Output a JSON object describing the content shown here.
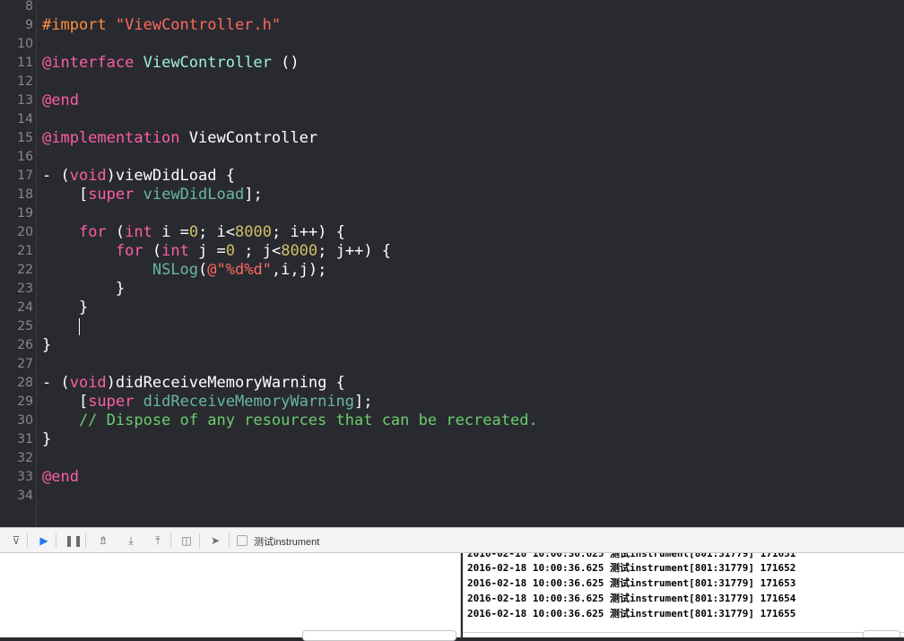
{
  "colors": {
    "editor_bg": "#292a30",
    "keyword": "#fc5fa3",
    "string": "#fc6a5d",
    "number": "#d0bf69",
    "comment": "#6bce6b",
    "class_name": "#9ef1dd",
    "method": "#67b7a4",
    "preprocessor": "#fd8f3f",
    "plain": "#ffffff",
    "line_number": "#868892"
  },
  "editor": {
    "lines": [
      {
        "num": "8",
        "tokens": []
      },
      {
        "num": "9",
        "tokens": [
          {
            "t": "#import ",
            "c": "#fd8f3f"
          },
          {
            "t": "\"ViewController.h\"",
            "c": "#fc6a5d"
          }
        ]
      },
      {
        "num": "10",
        "tokens": []
      },
      {
        "num": "11",
        "tokens": [
          {
            "t": "@interface",
            "c": "#fc5fa3"
          },
          {
            "t": " ",
            "c": "#ffffff"
          },
          {
            "t": "ViewController",
            "c": "#9ef1dd"
          },
          {
            "t": " ()",
            "c": "#ffffff"
          }
        ]
      },
      {
        "num": "12",
        "tokens": []
      },
      {
        "num": "13",
        "tokens": [
          {
            "t": "@end",
            "c": "#fc5fa3"
          }
        ]
      },
      {
        "num": "14",
        "tokens": []
      },
      {
        "num": "15",
        "tokens": [
          {
            "t": "@implementation",
            "c": "#fc5fa3"
          },
          {
            "t": " ViewController",
            "c": "#ffffff"
          }
        ]
      },
      {
        "num": "16",
        "tokens": []
      },
      {
        "num": "17",
        "tokens": [
          {
            "t": "- (",
            "c": "#ffffff"
          },
          {
            "t": "void",
            "c": "#fc5fa3"
          },
          {
            "t": ")viewDidLoad {",
            "c": "#ffffff"
          }
        ]
      },
      {
        "num": "18",
        "tokens": [
          {
            "t": "    [",
            "c": "#ffffff"
          },
          {
            "t": "super",
            "c": "#fc5fa3"
          },
          {
            "t": " ",
            "c": "#ffffff"
          },
          {
            "t": "viewDidLoad",
            "c": "#67b7a4"
          },
          {
            "t": "];",
            "c": "#ffffff"
          }
        ]
      },
      {
        "num": "19",
        "tokens": []
      },
      {
        "num": "20",
        "tokens": [
          {
            "t": "    ",
            "c": "#ffffff"
          },
          {
            "t": "for",
            "c": "#fc5fa3"
          },
          {
            "t": " (",
            "c": "#ffffff"
          },
          {
            "t": "int",
            "c": "#fc5fa3"
          },
          {
            "t": " i =",
            "c": "#ffffff"
          },
          {
            "t": "0",
            "c": "#d0bf69"
          },
          {
            "t": "; i<",
            "c": "#ffffff"
          },
          {
            "t": "8000",
            "c": "#d0bf69"
          },
          {
            "t": "; i++) {",
            "c": "#ffffff"
          }
        ]
      },
      {
        "num": "21",
        "tokens": [
          {
            "t": "        ",
            "c": "#ffffff"
          },
          {
            "t": "for",
            "c": "#fc5fa3"
          },
          {
            "t": " (",
            "c": "#ffffff"
          },
          {
            "t": "int",
            "c": "#fc5fa3"
          },
          {
            "t": " j =",
            "c": "#ffffff"
          },
          {
            "t": "0",
            "c": "#d0bf69"
          },
          {
            "t": " ; j<",
            "c": "#ffffff"
          },
          {
            "t": "8000",
            "c": "#d0bf69"
          },
          {
            "t": "; j++) {",
            "c": "#ffffff"
          }
        ]
      },
      {
        "num": "22",
        "tokens": [
          {
            "t": "            ",
            "c": "#ffffff"
          },
          {
            "t": "NSLog",
            "c": "#67b7a4"
          },
          {
            "t": "(",
            "c": "#ffffff"
          },
          {
            "t": "@\"%d%d\"",
            "c": "#fc6a5d"
          },
          {
            "t": ",i,j);",
            "c": "#ffffff"
          }
        ]
      },
      {
        "num": "23",
        "tokens": [
          {
            "t": "        }",
            "c": "#ffffff"
          }
        ]
      },
      {
        "num": "24",
        "tokens": [
          {
            "t": "    }",
            "c": "#ffffff"
          }
        ]
      },
      {
        "num": "25",
        "tokens": [
          {
            "t": "    ",
            "c": "#ffffff"
          }
        ],
        "cursor": true
      },
      {
        "num": "26",
        "tokens": [
          {
            "t": "}",
            "c": "#ffffff"
          }
        ]
      },
      {
        "num": "27",
        "tokens": []
      },
      {
        "num": "28",
        "tokens": [
          {
            "t": "- (",
            "c": "#ffffff"
          },
          {
            "t": "void",
            "c": "#fc5fa3"
          },
          {
            "t": ")didReceiveMemoryWarning {",
            "c": "#ffffff"
          }
        ]
      },
      {
        "num": "29",
        "tokens": [
          {
            "t": "    [",
            "c": "#ffffff"
          },
          {
            "t": "super",
            "c": "#fc5fa3"
          },
          {
            "t": " ",
            "c": "#ffffff"
          },
          {
            "t": "didReceiveMemoryWarning",
            "c": "#67b7a4"
          },
          {
            "t": "];",
            "c": "#ffffff"
          }
        ]
      },
      {
        "num": "30",
        "tokens": [
          {
            "t": "    // Dispose of any resources that can be recreated.",
            "c": "#6bce6b"
          }
        ]
      },
      {
        "num": "31",
        "tokens": [
          {
            "t": "}",
            "c": "#ffffff"
          }
        ]
      },
      {
        "num": "32",
        "tokens": []
      },
      {
        "num": "33",
        "tokens": [
          {
            "t": "@end",
            "c": "#fc5fa3"
          }
        ]
      },
      {
        "num": "34",
        "tokens": []
      }
    ]
  },
  "debug_bar": {
    "buttons": [
      {
        "name": "hide-debug-area-icon",
        "glyph": "⊽"
      },
      {
        "name": "breakpoints-toggle-icon",
        "glyph": "▶"
      },
      {
        "name": "pause-icon",
        "glyph": "❚❚"
      },
      {
        "name": "step-over-icon",
        "glyph": "⇯"
      },
      {
        "name": "step-into-icon",
        "glyph": "⤓"
      },
      {
        "name": "step-out-icon",
        "glyph": "⤒"
      },
      {
        "name": "view-debugger-icon",
        "glyph": "◫"
      },
      {
        "name": "simulate-location-icon",
        "glyph": "➤"
      }
    ],
    "target_label": "测试instrument"
  },
  "console": {
    "lines": [
      "2016-02-18 10:00:36.625 测试instrument[801:31779] 171652",
      "2016-02-18 10:00:36.625 测试instrument[801:31779] 171653",
      "2016-02-18 10:00:36.625 测试instrument[801:31779] 171654",
      "2016-02-18 10:00:36.625 测试instrument[801:31779] 171655"
    ]
  }
}
